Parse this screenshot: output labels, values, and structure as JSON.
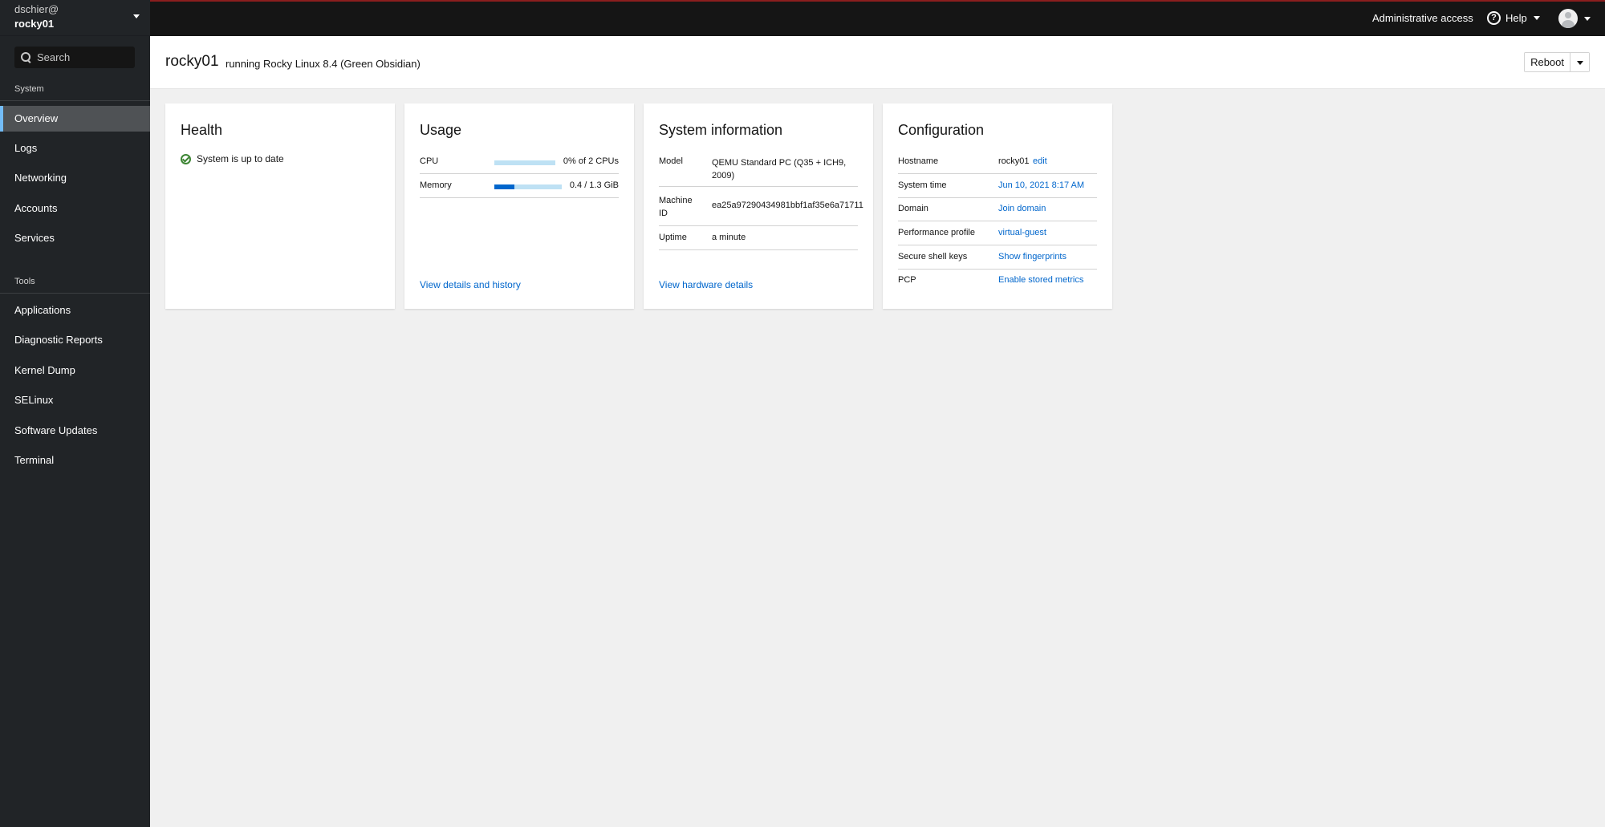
{
  "host": {
    "user": "dschier@",
    "name": "rocky01"
  },
  "search": {
    "placeholder": "Search"
  },
  "sidebar": {
    "system_title": "System",
    "tools_title": "Tools",
    "system_items": [
      "Overview",
      "Logs",
      "Networking",
      "Accounts",
      "Services"
    ],
    "tool_items": [
      "Applications",
      "Diagnostic Reports",
      "Kernel Dump",
      "SELinux",
      "Software Updates",
      "Terminal"
    ]
  },
  "topbar": {
    "admin": "Administrative access",
    "help": "Help"
  },
  "page": {
    "title": "rocky01",
    "subtitle": "running Rocky Linux 8.4 (Green Obsidian)",
    "reboot": "Reboot"
  },
  "health": {
    "title": "Health",
    "status": "System is up to date"
  },
  "usage": {
    "title": "Usage",
    "cpu_label": "CPU",
    "cpu_value": "0% of 2 CPUs",
    "cpu_fraction": 0.0,
    "mem_label": "Memory",
    "mem_value": "0.4 / 1.3 GiB",
    "mem_fraction": 0.3,
    "link": "View details and history"
  },
  "sysinfo": {
    "title": "System information",
    "model_label": "Model",
    "model_value_1": "QEMU Standard PC (Q35 + ICH9,",
    "model_value_2": "2009)",
    "machine_label_1": "Machine",
    "machine_label_2": "ID",
    "machine_value": "ea25a97290434981bbf1af35e6a71711",
    "uptime_label": "Uptime",
    "uptime_value": "a minute",
    "link": "View hardware details"
  },
  "config": {
    "title": "Configuration",
    "hostname_label": "Hostname",
    "hostname_value": "rocky01",
    "hostname_edit": "edit",
    "time_label": "System time",
    "time_value": "Jun 10, 2021 8:17 AM",
    "domain_label": "Domain",
    "domain_value": "Join domain",
    "perf_label": "Performance profile",
    "perf_value": "virtual-guest",
    "ssh_label": "Secure shell keys",
    "ssh_value": "Show fingerprints",
    "pcp_label": "PCP",
    "pcp_value": "Enable stored metrics"
  },
  "colors": {
    "accent": "#0066cc",
    "success": "#3e8635",
    "sidebar_bg": "#212427",
    "topbar_bg": "#151515"
  }
}
